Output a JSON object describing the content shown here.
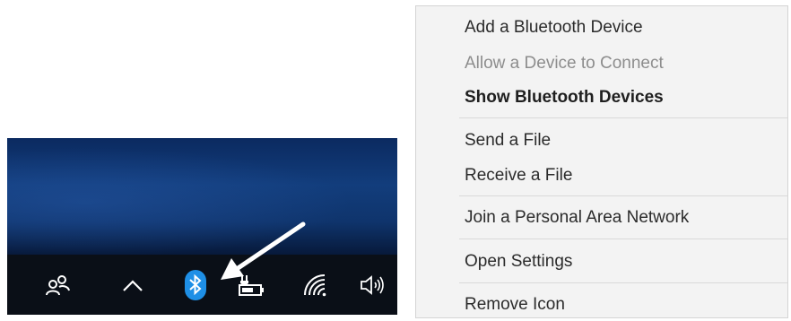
{
  "taskbar": {
    "icons": [
      {
        "name": "people-icon",
        "interactable": true
      },
      {
        "name": "show-hidden-icons-chevron-icon",
        "interactable": true
      },
      {
        "name": "bluetooth-icon",
        "interactable": true
      },
      {
        "name": "battery-charging-icon",
        "interactable": true
      },
      {
        "name": "wifi-icon",
        "interactable": true
      },
      {
        "name": "volume-icon",
        "interactable": true
      }
    ],
    "highlight_color": "#1e8fe6"
  },
  "menu": {
    "items": [
      {
        "label": "Add a Bluetooth Device",
        "state": "normal"
      },
      {
        "label": "Allow a Device to Connect",
        "state": "disabled"
      },
      {
        "label": "Show Bluetooth Devices",
        "state": "bold"
      },
      {
        "label": "Send a File",
        "state": "normal"
      },
      {
        "label": "Receive a File",
        "state": "normal"
      },
      {
        "label": "Join a Personal Area Network",
        "state": "normal"
      },
      {
        "label": "Open Settings",
        "state": "normal"
      },
      {
        "label": "Remove Icon",
        "state": "normal"
      }
    ]
  }
}
